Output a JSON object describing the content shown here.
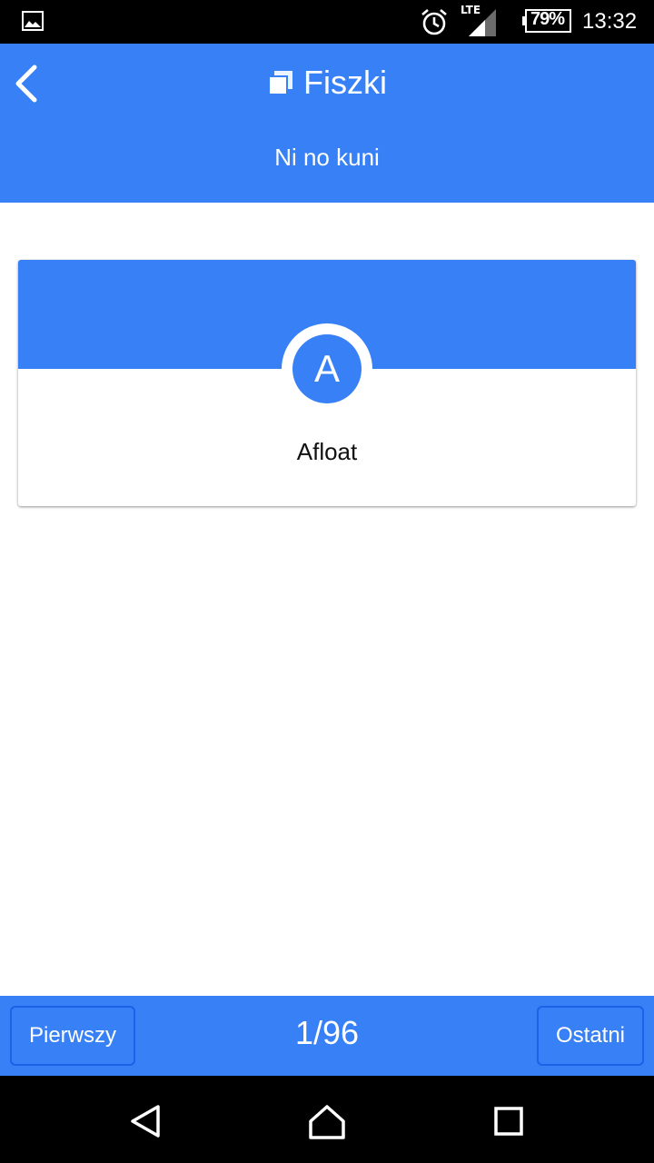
{
  "status_bar": {
    "network": "LTE",
    "battery": "79%",
    "time": "13:32",
    "icons": [
      "gallery-icon",
      "alarm-icon",
      "signal-icon",
      "battery-icon"
    ]
  },
  "header": {
    "title": "Fiszki",
    "subtitle": "Ni no kuni",
    "icons": [
      "back-arrow-icon",
      "cards-icon"
    ]
  },
  "card": {
    "initial": "A",
    "word": "Afloat"
  },
  "pager": {
    "first_label": "Pierwszy",
    "last_label": "Ostatni",
    "position": "1/96"
  },
  "nav_bar": {
    "icons": [
      "back-triangle-icon",
      "home-icon",
      "recent-apps-icon"
    ]
  },
  "colors": {
    "primary": "#3880f5",
    "status_bar": "#000000",
    "button_border": "#1a62e6",
    "text_dark": "#111111"
  }
}
